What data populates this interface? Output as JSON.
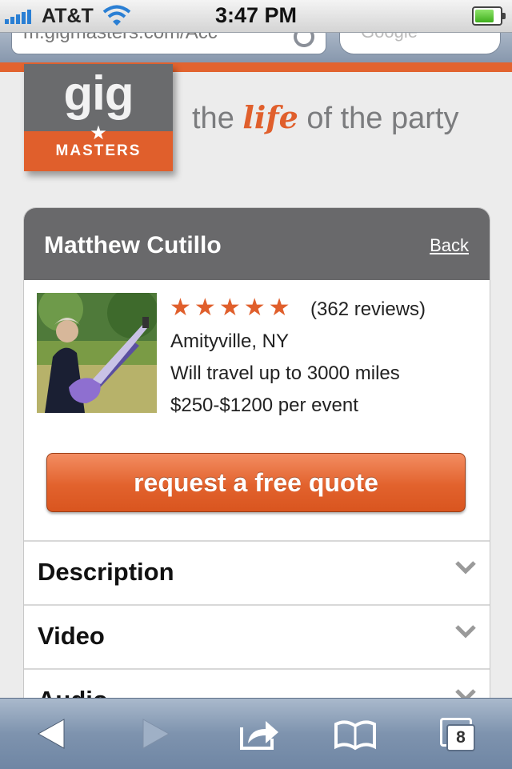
{
  "status_bar": {
    "carrier": "AT&T",
    "time": "3:47 PM",
    "battery_level": 0.9
  },
  "browser": {
    "url": "m.gigmasters.com/Acc",
    "search_placeholder": "Google",
    "tab_count": "8"
  },
  "logo": {
    "gig": "gig",
    "masters": "MASTERS",
    "tagline_pre": "the ",
    "tagline_life": "life",
    "tagline_post": " of the party"
  },
  "profile": {
    "name": "Matthew Cutillo",
    "back_label": "Back",
    "rating": 5,
    "rating_max": 5,
    "reviews": "(362 reviews)",
    "location": "Amityville, NY",
    "travel": "Will travel up to 3000 miles",
    "price": "$250-$1200 per event",
    "quote_button": "request a free quote"
  },
  "sections": [
    {
      "label": "Description"
    },
    {
      "label": "Video"
    },
    {
      "label": "Audio"
    }
  ],
  "colors": {
    "brand_orange": "#e05f2c",
    "header_gray": "#69696b"
  }
}
